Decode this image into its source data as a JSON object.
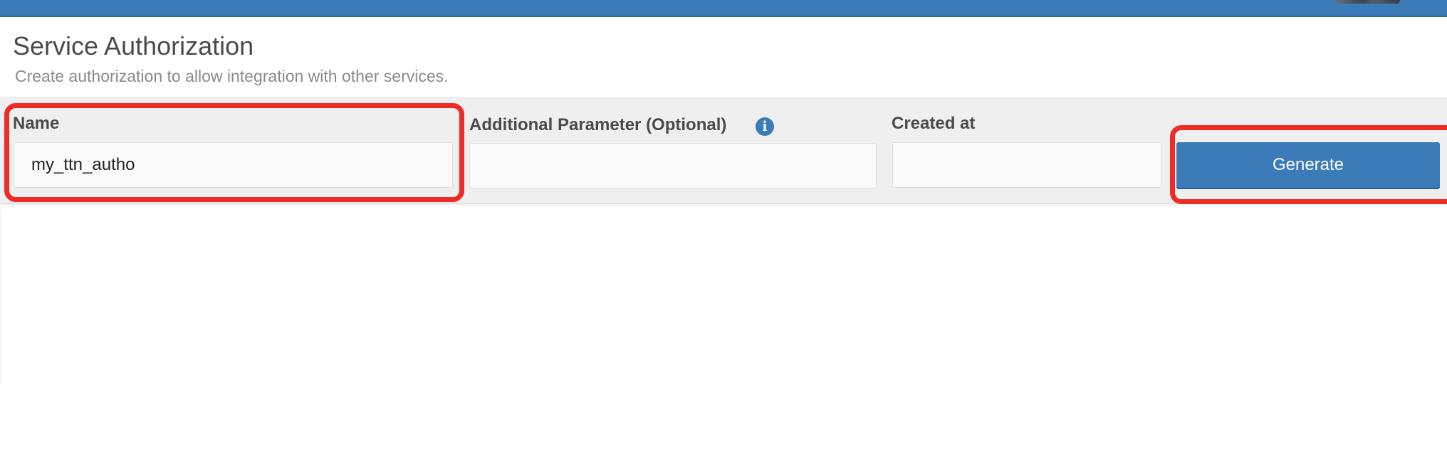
{
  "header": {
    "title": "Service Authorization",
    "subtitle": "Create authorization to allow integration with other services."
  },
  "form": {
    "name": {
      "label": "Name",
      "value": "my_ttn_autho"
    },
    "additional_parameter": {
      "label": "Additional Parameter (Optional)",
      "value": "",
      "info_icon": "info-icon"
    },
    "created_at": {
      "label": "Created at",
      "value": ""
    },
    "generate_label": "Generate"
  },
  "colors": {
    "accent": "#3a7bb8",
    "highlight": "#ee2b24",
    "form_band": "#efefef"
  }
}
